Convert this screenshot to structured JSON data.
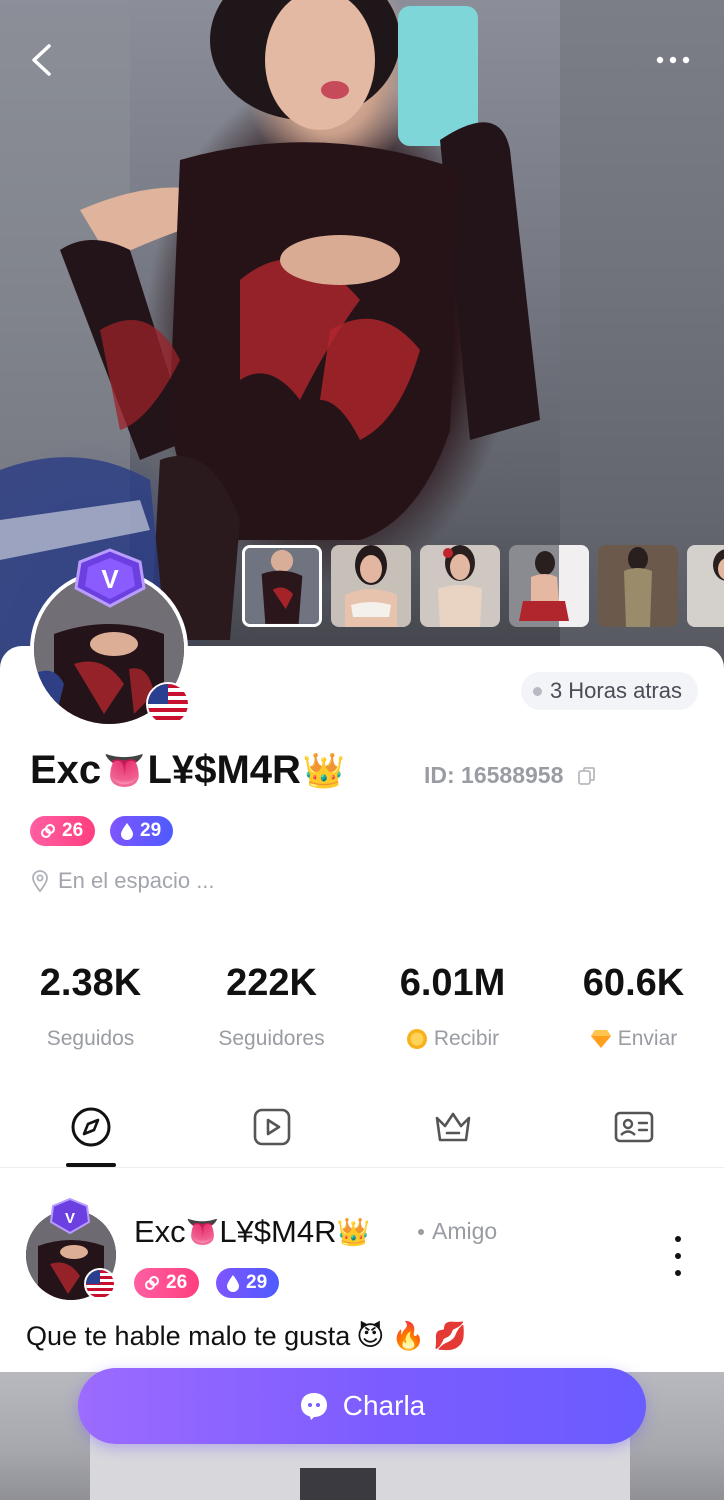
{
  "header": {
    "back_icon": "chevron-left-icon",
    "more_icon": "more-horizontal-icon"
  },
  "profile": {
    "username_text": "Exc",
    "username_emoji_1": "👅",
    "username_text_2": "L¥$M4R",
    "username_emoji_2": "👑",
    "id_label": "ID: 16588958",
    "last_seen": "3 Horas atras",
    "level_charm": "26",
    "level_wealth": "29",
    "location": "En el espacio ...",
    "country_flag": "us-flag-icon",
    "badge": "V"
  },
  "stats": [
    {
      "value": "2.38K",
      "label": "Seguidos"
    },
    {
      "value": "222K",
      "label": "Seguidores"
    },
    {
      "value": "6.01M",
      "label": "Recibir",
      "icon": "coin-icon"
    },
    {
      "value": "60.6K",
      "label": "Enviar",
      "icon": "diamond-icon"
    }
  ],
  "tabs": [
    {
      "name": "moments",
      "icon": "compass-icon",
      "active": true
    },
    {
      "name": "videos",
      "icon": "play-icon"
    },
    {
      "name": "privileges",
      "icon": "crown-icon"
    },
    {
      "name": "profile-info",
      "icon": "id-card-icon"
    }
  ],
  "post": {
    "author_text": "Exc",
    "author_emoji_1": "👅",
    "author_text_2": "L¥$M4R",
    "author_emoji_2": "👑",
    "relation": "Amigo",
    "level_charm": "26",
    "level_wealth": "29",
    "text": "Que te hable malo te gusta",
    "text_emojis": "😈 🔥 💋"
  },
  "chat_button": {
    "label": "Charla",
    "icon": "chat-bubble-icon"
  },
  "colors": {
    "accent": "#7b5cff",
    "pink_pill": "#ff3e7f",
    "purple_pill": "#4e5bff",
    "muted_text": "#9a9ca4"
  }
}
